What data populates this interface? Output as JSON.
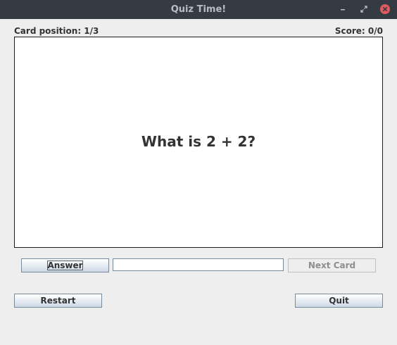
{
  "window": {
    "title": "Quiz Time!",
    "controls": {
      "minimize_icon": "minimize-icon",
      "maximize_icon": "maximize-icon",
      "close_icon": "close-icon"
    },
    "colors": {
      "titlebar": "#353b43",
      "title_text": "#b9bdc3",
      "close_button": "#e05a5f"
    }
  },
  "status": {
    "card_position": "Card position: 1/3",
    "score": "Score: 0/0"
  },
  "card": {
    "question": "What is 2 + 2?"
  },
  "controls": {
    "answer_label": "Answer",
    "answer_field_value": "",
    "next_label": "Next Card",
    "restart_label": "Restart",
    "quit_label": "Quit"
  }
}
